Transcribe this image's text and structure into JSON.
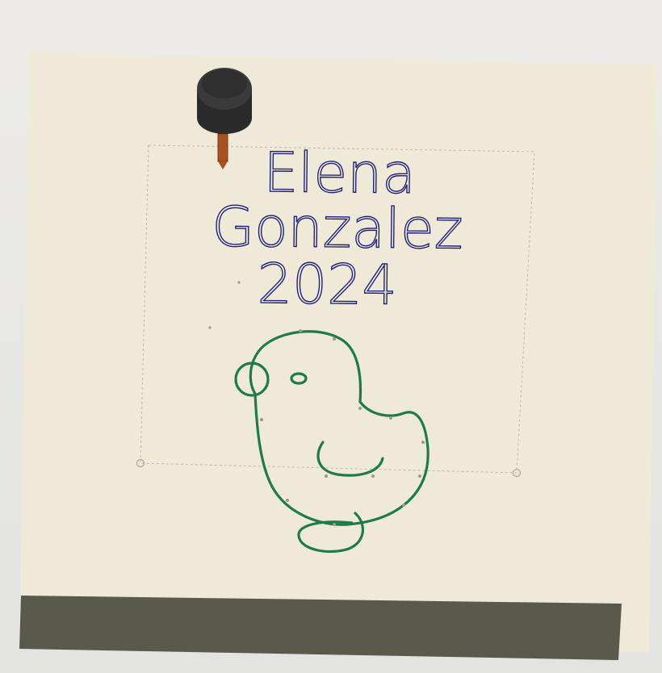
{
  "design": {
    "text_lines": [
      "Elena",
      "Gonzalez",
      "2024"
    ],
    "artwork": "chick-outline",
    "colors": {
      "workspace": "#efead7",
      "text_path": "#1f1f7a",
      "artwork_path": "#1f7a4a",
      "bounding_box": "#b9b7ae",
      "bottom_bar": "#5a5a4c",
      "tool_holder": "#2b2b2b",
      "tool_bit": "#a8531f"
    }
  }
}
